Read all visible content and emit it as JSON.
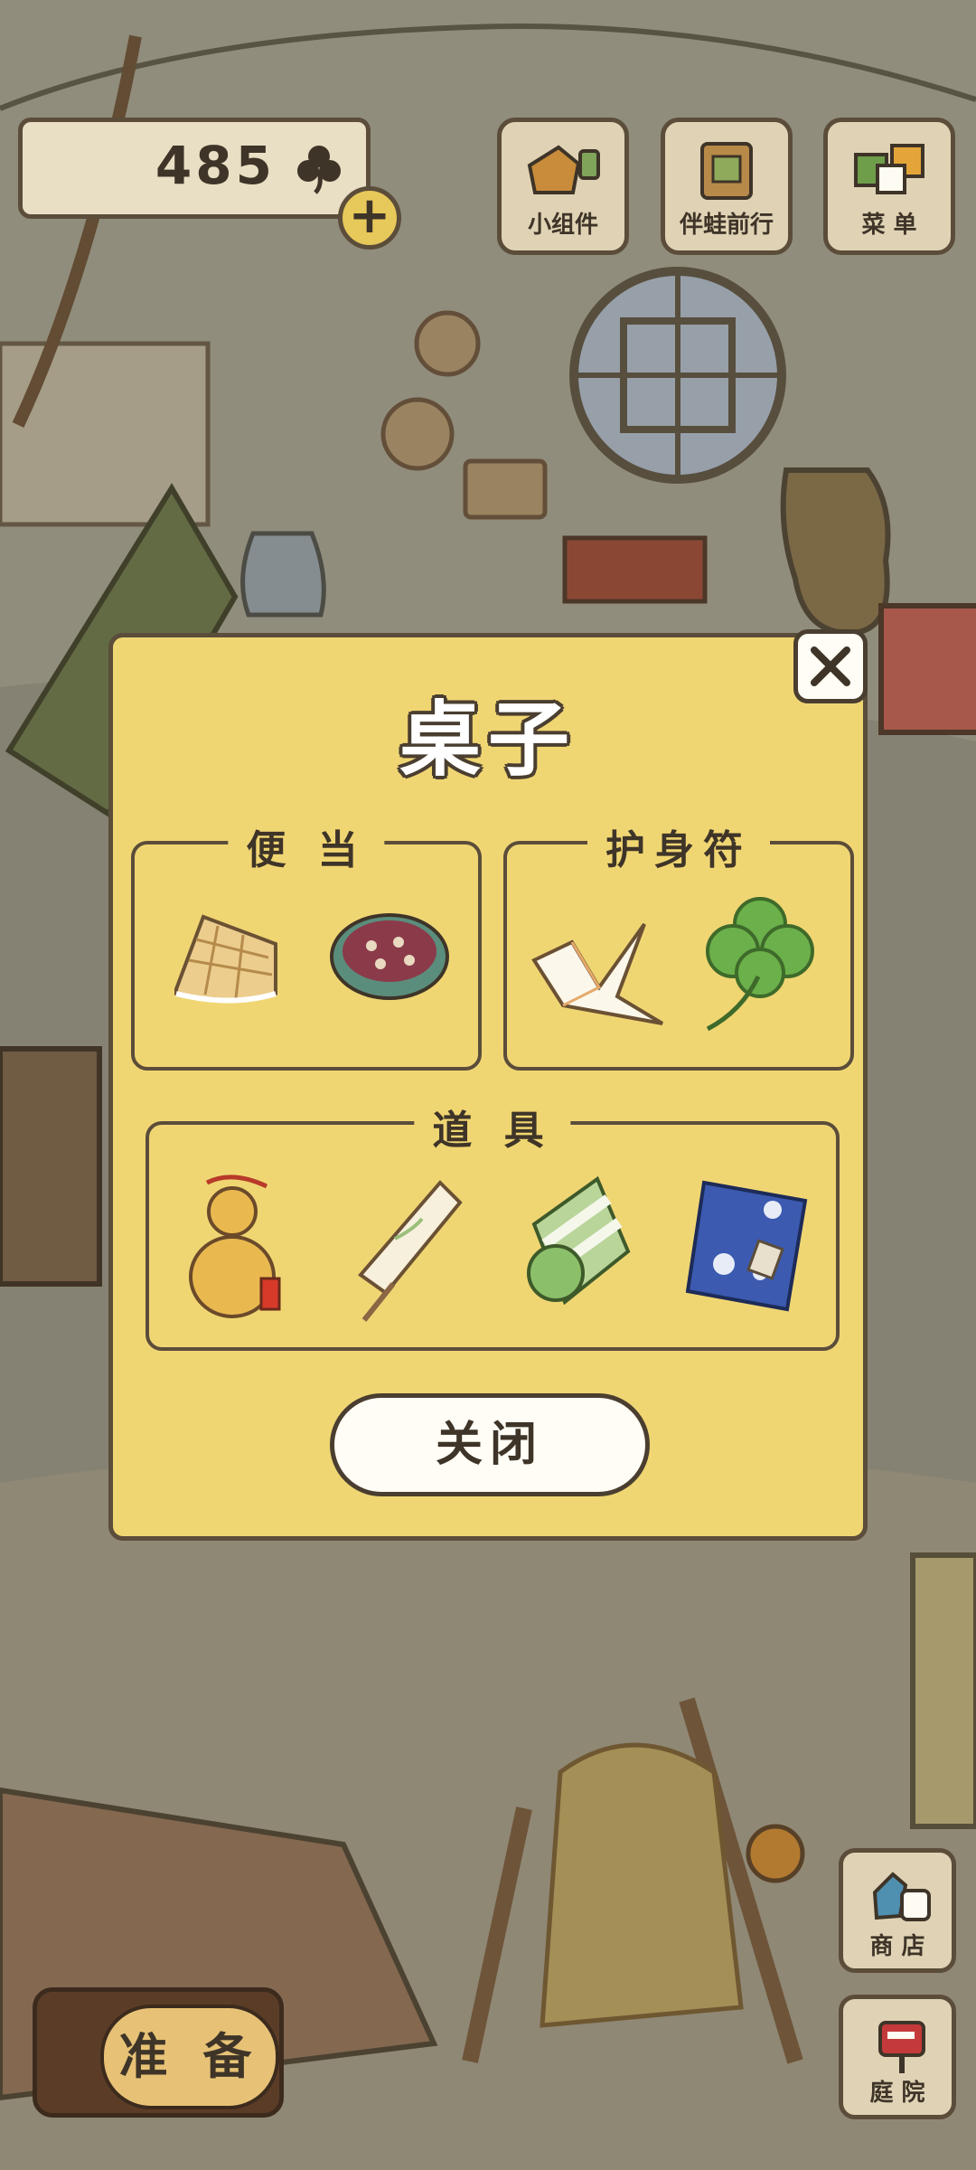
{
  "hud": {
    "clover_count": "485",
    "buttons": [
      {
        "label": "小组件",
        "icon": "widget-icon"
      },
      {
        "label": "伴蛙前行",
        "icon": "journey-book-icon"
      },
      {
        "label": "菜 单",
        "icon": "menu-cards-icon"
      }
    ]
  },
  "dialog": {
    "title": "桌子",
    "groups": {
      "bento": {
        "label": "便 当",
        "items": [
          "waffle",
          "bean-porridge"
        ]
      },
      "amulet": {
        "label": "护身符",
        "items": [
          "paper-crane",
          "four-leaf-clover"
        ]
      },
      "tools": {
        "label": "道 具",
        "items": [
          "gourd",
          "paper-umbrella",
          "green-bedroll",
          "blue-furoshiki"
        ]
      }
    },
    "close_label": "关闭"
  },
  "bottom": {
    "ready_label": "准 备",
    "shop_label": "商 店",
    "garden_label": "庭 院"
  },
  "colors": {
    "dialog_bg": "#f0d673",
    "outline": "#5b4d3a",
    "button_bg": "#e0d3b5"
  }
}
